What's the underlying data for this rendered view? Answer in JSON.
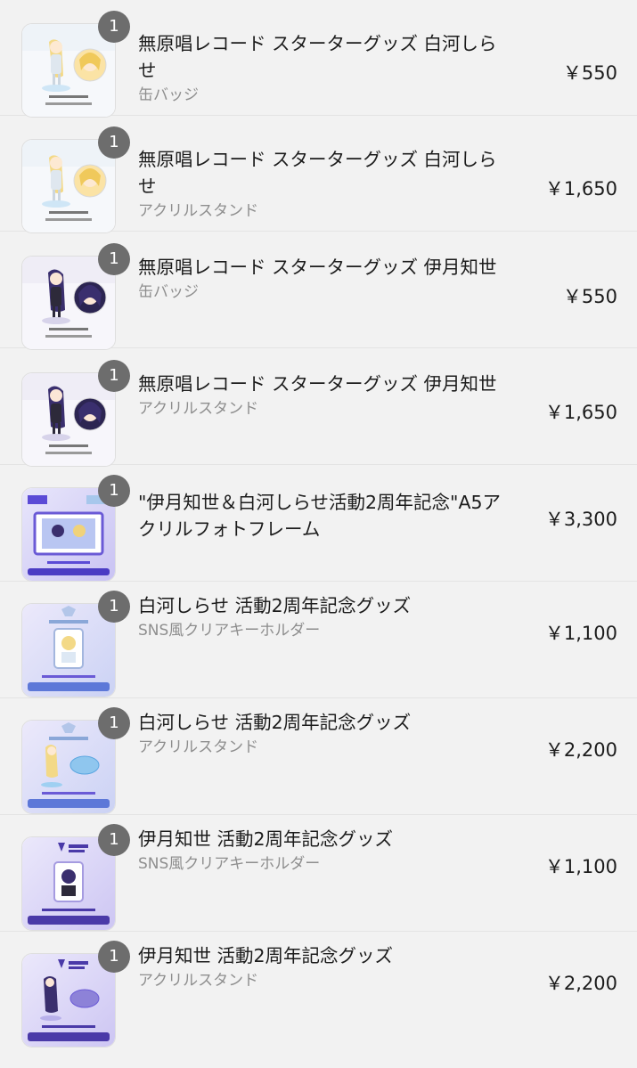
{
  "cart": {
    "items": [
      {
        "qty": "1",
        "title": "無原唱レコード スターターグッズ 白河しらせ",
        "variant": "缶バッジ",
        "price": "￥550",
        "thumb_theme": "white",
        "accent": "#f0c95b"
      },
      {
        "qty": "1",
        "title": "無原唱レコード スターターグッズ 白河しらせ",
        "variant": "アクリルスタンド",
        "price": "￥1,650",
        "thumb_theme": "white",
        "accent": "#f0c95b"
      },
      {
        "qty": "1",
        "title": "無原唱レコード スターターグッズ 伊月知世",
        "variant": "缶バッジ",
        "price": "￥550",
        "thumb_theme": "white",
        "accent": "#3a2f6e"
      },
      {
        "qty": "1",
        "title": "無原唱レコード スターターグッズ 伊月知世",
        "variant": "アクリルスタンド",
        "price": "￥1,650",
        "thumb_theme": "white",
        "accent": "#3a2f6e"
      },
      {
        "qty": "1",
        "title": "\"伊月知世＆白河しらせ活動2周年記念\"A5アクリルフォトフレーム",
        "variant": "",
        "price": "￥3,300",
        "thumb_theme": "purple",
        "accent": "#5b4bd6"
      },
      {
        "qty": "1",
        "title": "白河しらせ 活動2周年記念グッズ",
        "variant": "SNS風クリアキーホルダー",
        "price": "￥1,100",
        "thumb_theme": "purple",
        "accent": "#7db8e8"
      },
      {
        "qty": "1",
        "title": "白河しらせ 活動2周年記念グッズ",
        "variant": "アクリルスタンド",
        "price": "￥2,200",
        "thumb_theme": "purple",
        "accent": "#7db8e8"
      },
      {
        "qty": "1",
        "title": "伊月知世 活動2周年記念グッズ",
        "variant": "SNS風クリアキーホルダー",
        "price": "￥1,100",
        "thumb_theme": "purple",
        "accent": "#4a3aa8"
      },
      {
        "qty": "1",
        "title": "伊月知世 活動2周年記念グッズ",
        "variant": "アクリルスタンド",
        "price": "￥2,200",
        "thumb_theme": "purple",
        "accent": "#4a3aa8"
      }
    ],
    "colors": {
      "background": "#f2f2f2",
      "badge": "#6d6d6d",
      "text_primary": "#1c1c1c",
      "text_secondary": "#8e8e8e"
    }
  }
}
